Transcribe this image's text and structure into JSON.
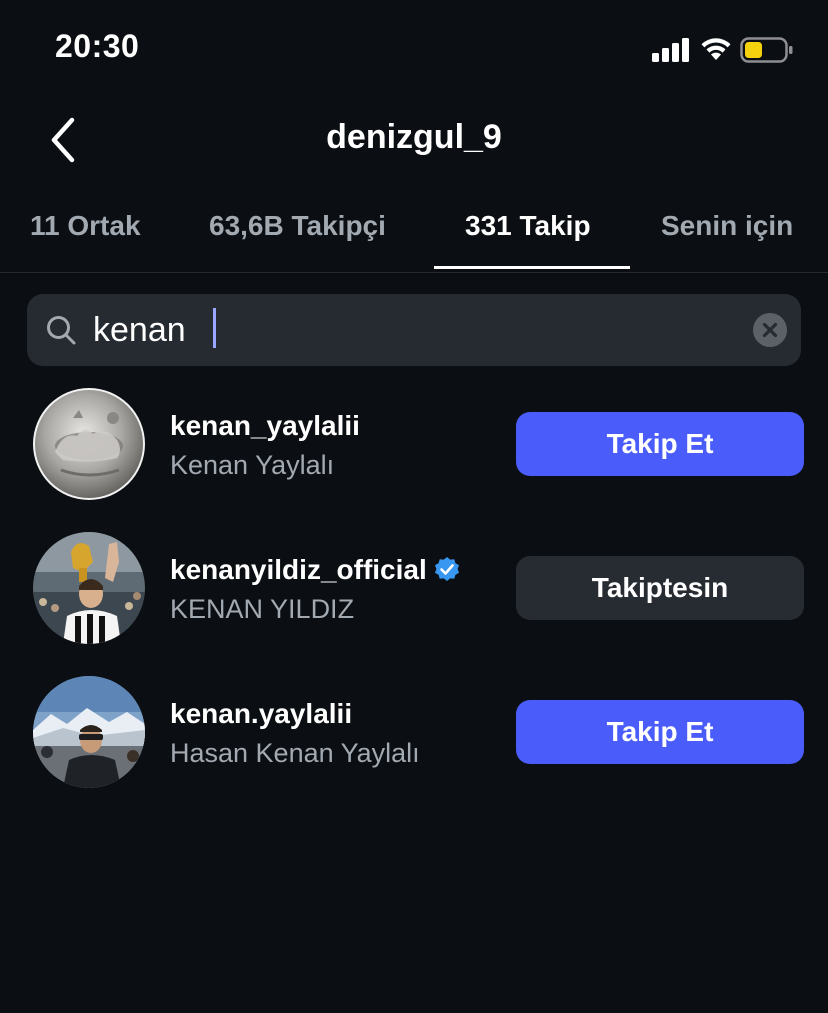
{
  "status_bar": {
    "time": "20:30",
    "signal_icon": "cellular-signal-icon",
    "wifi_icon": "wifi-icon",
    "battery_icon": "battery-icon",
    "battery_color": "#f5d20e"
  },
  "header": {
    "back_icon": "chevron-left-icon",
    "title": "denizgul_9"
  },
  "tabs": [
    {
      "label": "11 Ortak",
      "active": false
    },
    {
      "label": "63,6B Takipçi",
      "active": false
    },
    {
      "label": "331 Takip",
      "active": true
    },
    {
      "label": "Senin için",
      "active": false
    }
  ],
  "search": {
    "value": "kenan",
    "search_icon": "search-icon",
    "clear_icon": "clear-icon"
  },
  "results": [
    {
      "username": "kenan_yaylalii",
      "full_name": "Kenan Yaylalı",
      "verified": false,
      "button_label": "Takip Et",
      "button_style": "primary"
    },
    {
      "username": "kenanyildiz_official",
      "full_name": "KENAN YILDIZ",
      "verified": true,
      "button_label": "Takiptesin",
      "button_style": "secondary"
    },
    {
      "username": "kenan.yaylalii",
      "full_name": "Hasan Kenan Yaylalı",
      "verified": false,
      "button_label": "Takip Et",
      "button_style": "primary"
    }
  ],
  "colors": {
    "background": "#0b0f14",
    "primary_button": "#4a5dfb",
    "secondary_button": "#272b32",
    "verified_badge": "#3897f0",
    "muted_text": "#a3a9b1"
  }
}
